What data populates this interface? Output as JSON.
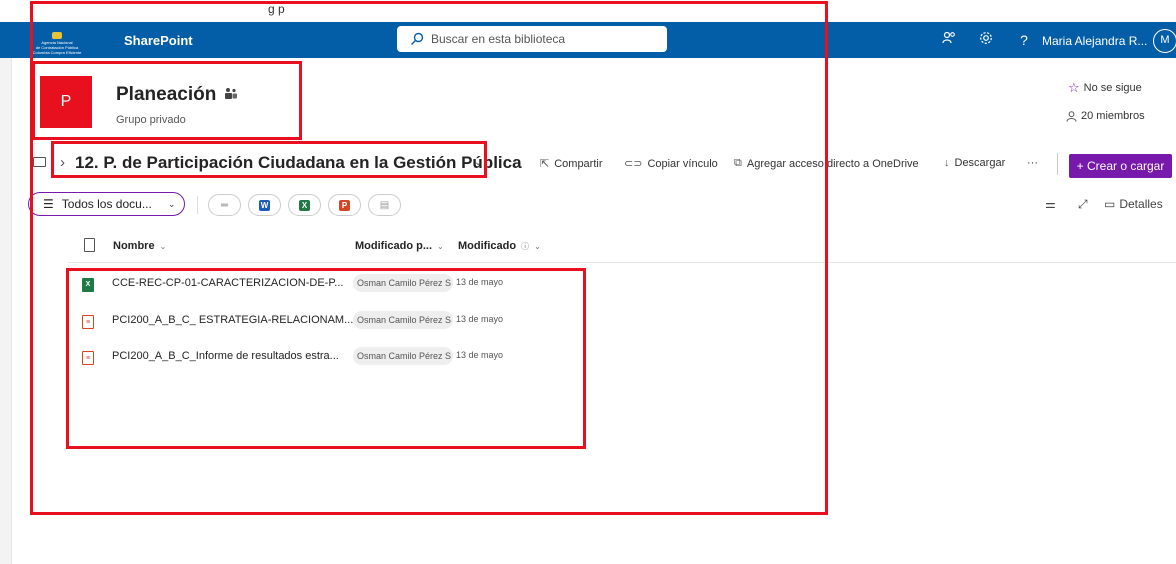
{
  "top_clip": {
    "text": "g                          p"
  },
  "suite_bar": {
    "org_logo_lines": [
      "Agencia Nacional",
      "de Contratación Pública",
      "Colombia Compra Eficiente"
    ],
    "brand": "SharePoint",
    "search_placeholder": "Buscar en esta biblioteca",
    "user_name": "Maria Alejandra R...",
    "user_initial": "M",
    "accent": "#045ea7"
  },
  "site": {
    "logo_letter": "P",
    "title": "Planeación",
    "subtitle": "Grupo privado",
    "follow_label": "No se sigue",
    "members_label": "20 miembros",
    "logo_color": "#e8101e"
  },
  "breadcrumb": {
    "current": "12. P. de Participación Ciudadana en la Gestión Pública"
  },
  "commands": {
    "share": "Compartir",
    "copy_link": "Copiar vínculo",
    "onedrive": "Agregar acceso directo a OneDrive",
    "download": "Descargar",
    "more": "···",
    "create": "+ Crear o cargar",
    "create_color": "#7719aa"
  },
  "view": {
    "current_view": "Todos los docu...",
    "details": "Detalles"
  },
  "columns": {
    "name": "Nombre",
    "modified_by": "Modificado p...",
    "modified": "Modificado"
  },
  "files": [
    {
      "name": "CCE-REC-CP-01-CARACTERIZACION-DE-P...",
      "modified_by": "Osman Camilo Pérez S",
      "modified": "13 de mayo",
      "type": "excel"
    },
    {
      "name": "PCI200_A_B_C_ ESTRATEGIA-RELACIONAM...",
      "modified_by": "Osman Camilo Pérez S",
      "modified": "13 de mayo",
      "type": "pdf"
    },
    {
      "name": "PCI200_A_B_C_Informe de resultados estra...",
      "modified_by": "Osman Camilo Pérez S",
      "modified": "13 de mayo",
      "type": "pdf"
    }
  ]
}
